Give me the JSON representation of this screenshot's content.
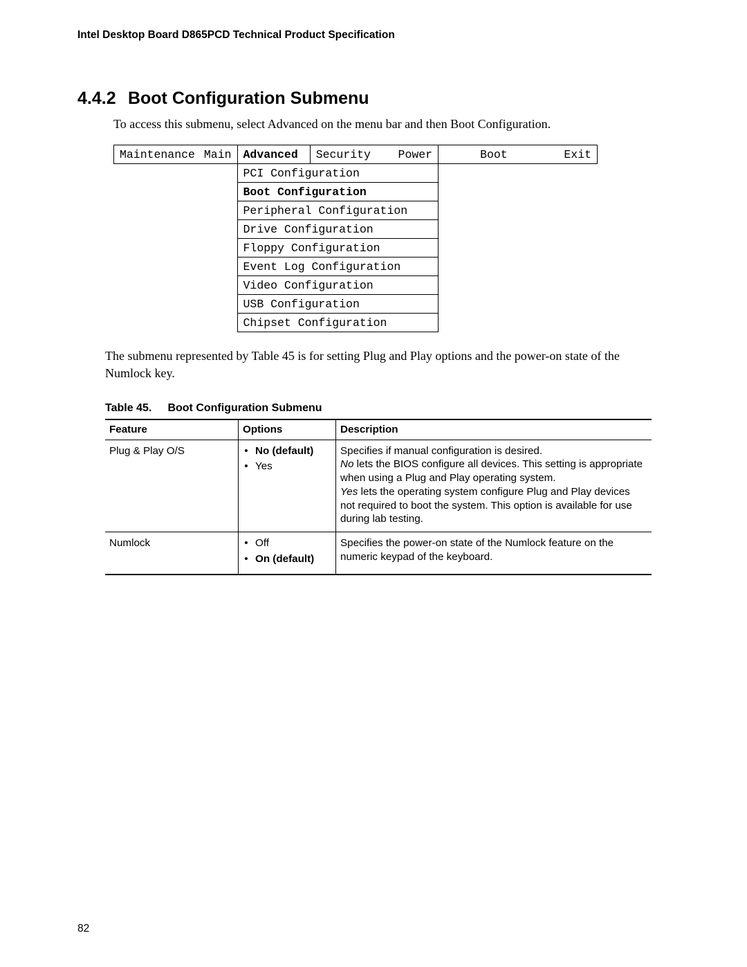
{
  "header": "Intel Desktop Board D865PCD Technical Product Specification",
  "section": {
    "number": "4.4.2",
    "title": "Boot Configuration Submenu"
  },
  "intro": "To access this submenu, select Advanced on the menu bar and then Boot Configuration.",
  "bios_menu": {
    "top": {
      "maintenance": "Maintenance",
      "main": "Main",
      "advanced": "Advanced",
      "security": "Security",
      "power": "Power",
      "boot": "Boot",
      "exit": "Exit"
    },
    "submenu": [
      "PCI Configuration",
      "Boot Configuration",
      "Peripheral Configuration",
      "Drive Configuration",
      "Floppy Configuration",
      "Event Log Configuration",
      "Video Configuration",
      "USB Configuration",
      "Chipset Configuration"
    ],
    "active_submenu_index": 1
  },
  "after_menu": "The submenu represented by Table 45 is for setting Plug and Play options and the power-on state of the Numlock key.",
  "table": {
    "caption_number": "Table 45.",
    "caption_title": "Boot Configuration Submenu",
    "headers": {
      "feature": "Feature",
      "options": "Options",
      "description": "Description"
    },
    "rows": [
      {
        "feature": "Plug & Play O/S",
        "options": [
          {
            "label": "No (default)",
            "bold": true
          },
          {
            "label": "Yes",
            "bold": false
          }
        ],
        "desc_line1": "Specifies if manual configuration is desired.",
        "desc_no_prefix": "No",
        "desc_no_rest": " lets the BIOS configure all devices.  This setting is appropriate when using a Plug and Play operating system.",
        "desc_yes_prefix": "Yes",
        "desc_yes_rest": " lets the operating system configure Plug and Play devices not required to boot the system.  This option is available for use during lab testing."
      },
      {
        "feature": "Numlock",
        "options": [
          {
            "label": "Off",
            "bold": false
          },
          {
            "label": "On (default)",
            "bold": true
          }
        ],
        "desc_plain": "Specifies the power-on state of the Numlock feature on the numeric keypad of the keyboard."
      }
    ]
  },
  "page_number": "82"
}
